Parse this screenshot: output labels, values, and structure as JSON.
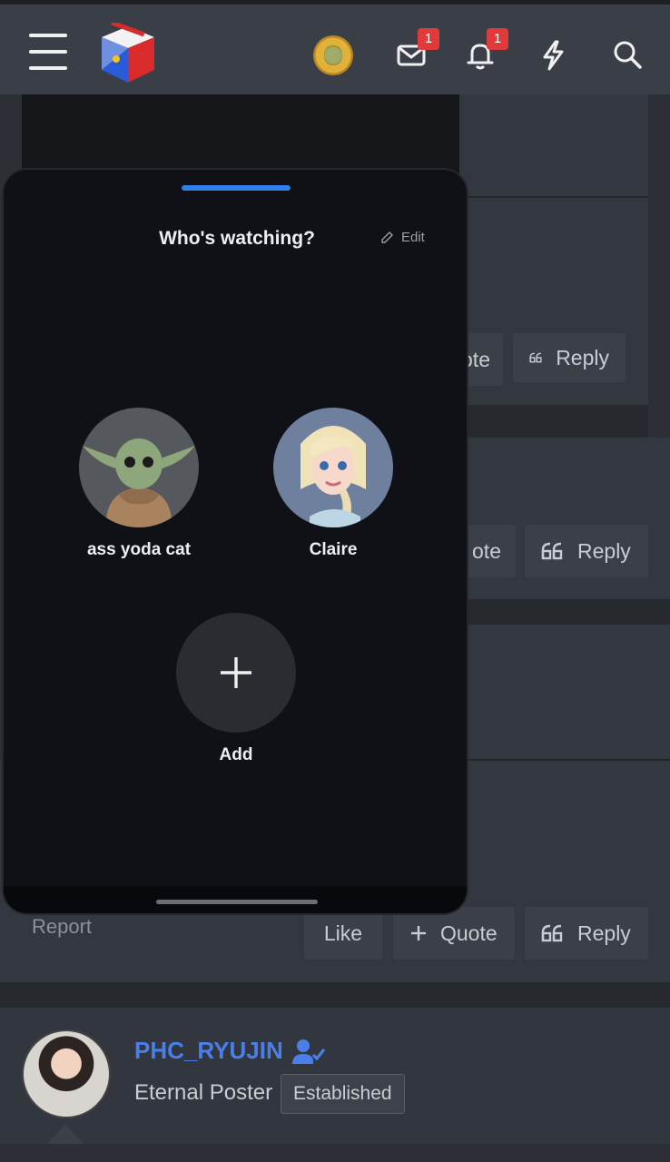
{
  "header": {
    "messages_badge": "1",
    "alerts_badge": "1"
  },
  "profiles_sheet": {
    "title": "Who's watching?",
    "edit_label": "Edit",
    "profiles": [
      {
        "name": "ass yoda cat"
      },
      {
        "name": "Claire"
      }
    ],
    "add_label": "Add"
  },
  "post_actions": {
    "quote_partial": "ote",
    "reply_label": "Reply",
    "like_label": "Like",
    "quote_label": "Quote",
    "report_label": "Report"
  },
  "next_post": {
    "username": "PHC_RYUJIN",
    "user_title": "Eternal Poster",
    "role_badge": "Established"
  },
  "colors": {
    "accent_blue": "#2f80ed",
    "username_blue": "#4a7ee8",
    "badge_red": "#e03a3a"
  }
}
